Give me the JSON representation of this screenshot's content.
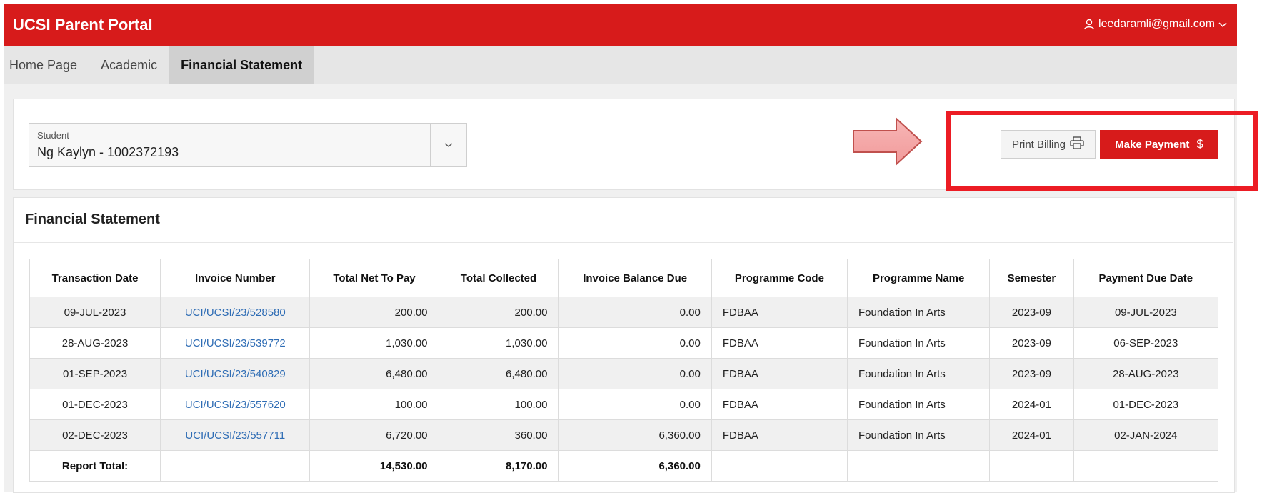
{
  "app": {
    "title": "UCSI Parent Portal",
    "user_email": "leedaramli@gmail.com"
  },
  "nav": {
    "tabs": [
      {
        "label": "Home Page",
        "active": false
      },
      {
        "label": "Academic",
        "active": false
      },
      {
        "label": "Financial Statement",
        "active": true
      }
    ]
  },
  "student_select": {
    "label": "Student",
    "value": "Ng Kaylyn - 1002372193"
  },
  "actions": {
    "print_label": "Print Billing",
    "pay_label": "Make Payment",
    "pay_symbol": "$"
  },
  "statement": {
    "title": "Financial Statement",
    "columns": [
      "Transaction Date",
      "Invoice Number",
      "Total Net To Pay",
      "Total Collected",
      "Invoice Balance Due",
      "Programme Code",
      "Programme Name",
      "Semester",
      "Payment Due Date"
    ],
    "rows": [
      [
        "09-JUL-2023",
        "UCI/UCSI/23/528580",
        "200.00",
        "200.00",
        "0.00",
        "FDBAA",
        "Foundation In Arts",
        "2023-09",
        "09-JUL-2023"
      ],
      [
        "28-AUG-2023",
        "UCI/UCSI/23/539772",
        "1,030.00",
        "1,030.00",
        "0.00",
        "FDBAA",
        "Foundation In Arts",
        "2023-09",
        "06-SEP-2023"
      ],
      [
        "01-SEP-2023",
        "UCI/UCSI/23/540829",
        "6,480.00",
        "6,480.00",
        "0.00",
        "FDBAA",
        "Foundation In Arts",
        "2023-09",
        "28-AUG-2023"
      ],
      [
        "01-DEC-2023",
        "UCI/UCSI/23/557620",
        "100.00",
        "100.00",
        "0.00",
        "FDBAA",
        "Foundation In Arts",
        "2024-01",
        "01-DEC-2023"
      ],
      [
        "02-DEC-2023",
        "UCI/UCSI/23/557711",
        "6,720.00",
        "360.00",
        "6,360.00",
        "FDBAA",
        "Foundation In Arts",
        "2024-01",
        "02-JAN-2024"
      ]
    ],
    "total": {
      "label": "Report Total:",
      "net_to_pay": "14,530.00",
      "collected": "8,170.00",
      "balance_due": "6,360.00"
    }
  },
  "colors": {
    "brand_red": "#d71b1b",
    "highlight_red": "#ec1c24",
    "link_blue": "#2f6db5",
    "arrow_fill": "#f4a5a5"
  },
  "icons": {
    "user": "user-icon",
    "chevron": "chevron-down-icon",
    "print": "printer-icon",
    "arrow": "right-arrow-annotation"
  }
}
